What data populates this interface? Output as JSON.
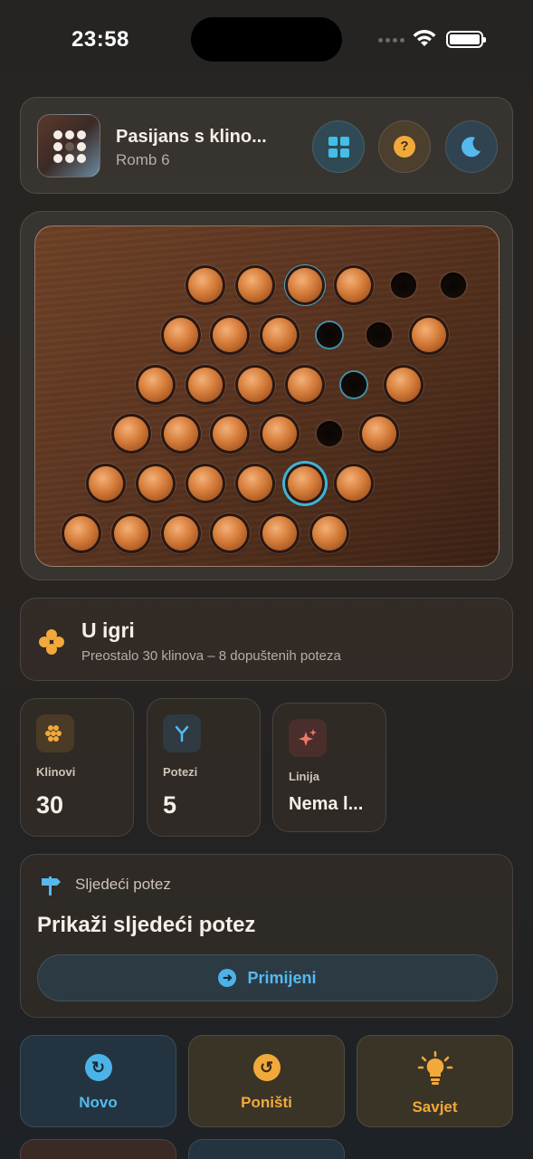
{
  "status_bar": {
    "time": "23:58"
  },
  "header": {
    "title": "Pasijans s klino...",
    "subtitle": "Romb 6",
    "icons": [
      "grid-icon",
      "help-icon",
      "moon-icon"
    ],
    "help_glyph": "?"
  },
  "board": {
    "rows": [
      [
        "full",
        "full",
        "full-hl",
        "full",
        "empty",
        "empty"
      ],
      [
        "full",
        "full",
        "full",
        "empty-hl",
        "empty",
        "full"
      ],
      [
        "full",
        "full",
        "full",
        "full",
        "empty-hl",
        "full"
      ],
      [
        "full",
        "full",
        "full",
        "full",
        "empty",
        "full"
      ],
      [
        "full",
        "full",
        "full",
        "full",
        "full-sel",
        "full"
      ],
      [
        "full",
        "full",
        "full",
        "full",
        "full",
        "full"
      ]
    ]
  },
  "status": {
    "title": "U igri",
    "subtitle": "Preostalo 30 klinova – 8 dopuštenih poteza"
  },
  "stats": [
    {
      "label": "Klinovi",
      "value": "30",
      "icon": "pegs-icon",
      "color": "#f2a93b"
    },
    {
      "label": "Potezi",
      "value": "5",
      "icon": "fork-icon",
      "color": "#56b9ee"
    },
    {
      "label": "Linija",
      "value": "Nema l...",
      "icon": "sparkles-icon",
      "color": "#f0776a"
    }
  ],
  "hint": {
    "header": "Sljedeći potez",
    "title": "Prikaži sljedeći potez",
    "apply_label": "Primijeni",
    "apply_glyph": "➜"
  },
  "actions": [
    {
      "label": "Novo",
      "icon": "restart-icon",
      "glyph": "↻"
    },
    {
      "label": "Poništi",
      "icon": "undo-icon",
      "glyph": "↺"
    },
    {
      "label": "Savjet",
      "icon": "lightbulb-icon"
    }
  ],
  "colors": {
    "accent_blue": "#56b9ee",
    "accent_orange": "#f2a93b",
    "wood": "#5a3420"
  }
}
